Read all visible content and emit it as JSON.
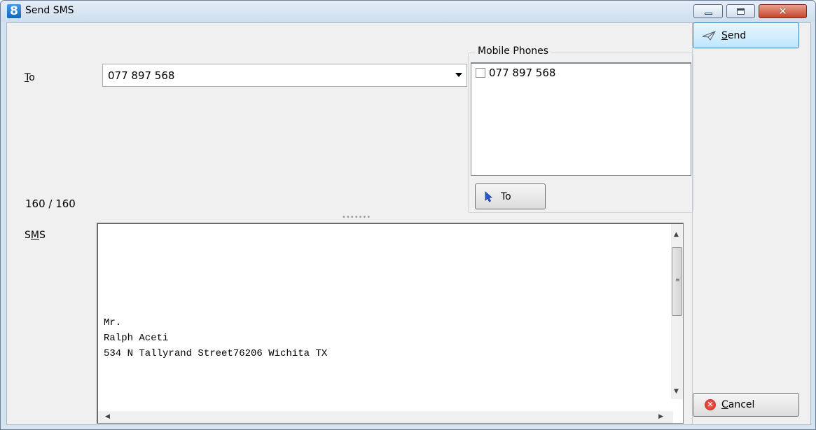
{
  "window": {
    "app_icon_text": "8",
    "title": "Send SMS",
    "close_glyph": "✕"
  },
  "form": {
    "to_label_mnemonic": "T",
    "to_label_rest": "o",
    "to_value": "077 897 568",
    "counter": "160 / 160",
    "sms_label_pre": "S",
    "sms_label_mnemonic": "M",
    "sms_label_post": "S",
    "sms_text": "Mr.\nRalph Aceti\n534 N Tallyrand Street76206 Wichita TX"
  },
  "mobile_phones": {
    "title": "Mobile Phones",
    "items": [
      {
        "label": "077 897 568",
        "checked": false
      }
    ],
    "to_button_label": "To"
  },
  "actions": {
    "send_mnemonic": "S",
    "send_rest": "end",
    "cancel_mnemonic": "C",
    "cancel_rest": "ancel"
  },
  "icons": {
    "send": "paper-plane-icon",
    "cancel": "cancel-icon",
    "to_button": "cursor-arrow-icon",
    "dropdown": "chevron-down-icon"
  },
  "colors": {
    "accent": "#3c7fb1",
    "cancel_red": "#c0201a",
    "app_icon": "#1565c0"
  }
}
